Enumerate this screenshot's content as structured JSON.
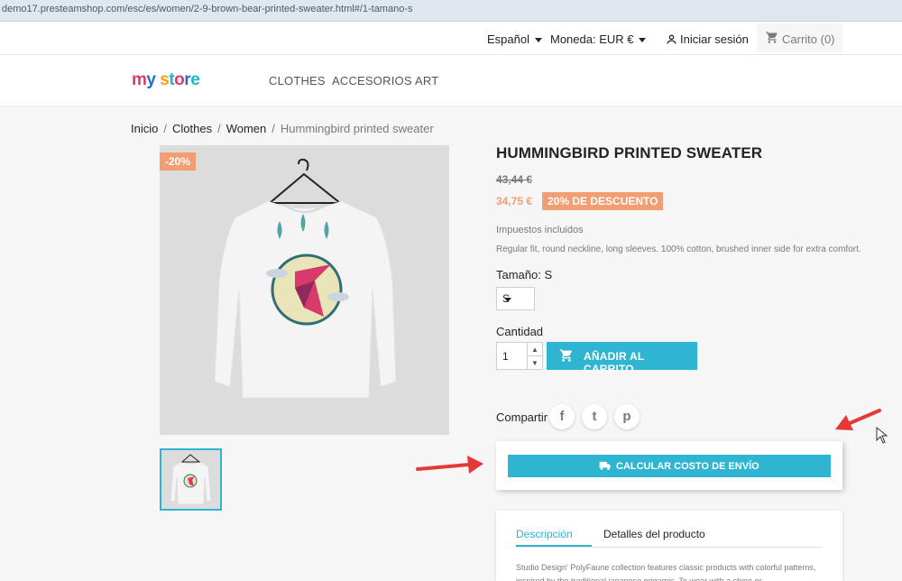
{
  "browser": {
    "url": "demo17.presteamshop.com/esc/es/women/2-9-brown-bear-printed-sweater.html#/1-tamano-s"
  },
  "topnav": {
    "language": "Español",
    "currency": "Moneda: EUR €",
    "login": "Iniciar sesión",
    "cart": "Carrito (0)"
  },
  "header": {
    "logo_parts": [
      "my",
      " ",
      "st",
      "ore"
    ],
    "menu": [
      "CLOTHES",
      "ACCESORIOS",
      "ART"
    ]
  },
  "breadcrumb": [
    "Inicio",
    "Clothes",
    "Women",
    "Hummingbird printed sweater"
  ],
  "product": {
    "badge": "-20%",
    "title": "HUMMINGBIRD PRINTED SWEATER",
    "old_price": "43,44 €",
    "price": "34,75 €",
    "discount": "20% DE DESCUENTO",
    "tax_note": "Impuestos incluidos",
    "short_desc": "Regular fit, round neckline, long sleeves. 100% cotton, brushed inner side for extra comfort.",
    "size_label": "Tamaño: S",
    "size_value": "S",
    "qty_label": "Cantidad",
    "qty_value": "1",
    "add_to_cart": "AÑADIR AL CARRITO",
    "share_label": "Compartir",
    "share_icons": [
      "f",
      "t",
      "p"
    ],
    "shipping_button": "CALCULAR COSTO DE ENVÍO"
  },
  "tabs": {
    "items": [
      "Descripción",
      "Detalles del producto"
    ],
    "text": "Studio Design' PolyFaune collection features classic products with colorful patterns, inspired by the traditional japanese origamis. To wear with a chino or"
  },
  "colors": {
    "accent": "#2fb5d2",
    "discount": "#f39d72",
    "arrow": "#e53935"
  }
}
